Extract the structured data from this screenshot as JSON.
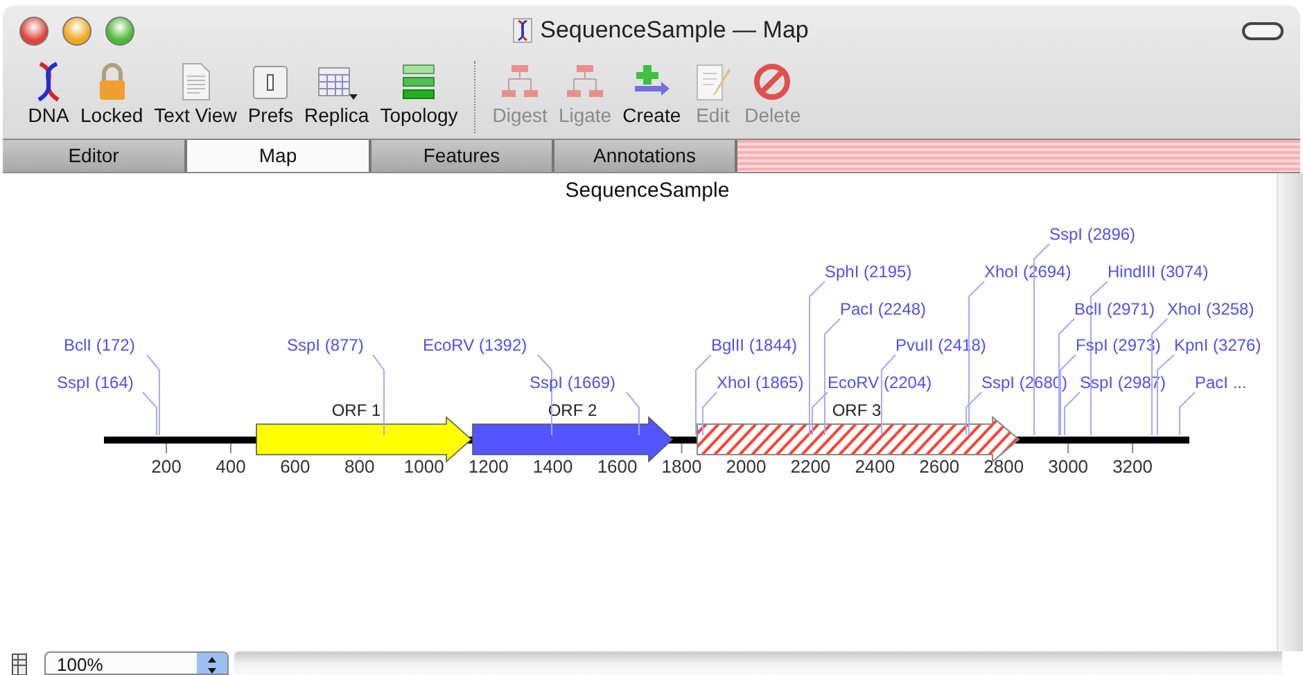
{
  "window": {
    "title": "SequenceSample — Map"
  },
  "toolbar": [
    {
      "label": "DNA",
      "kind": "dna",
      "disabled": false
    },
    {
      "label": "Locked",
      "kind": "lock",
      "disabled": false
    },
    {
      "label": "Text View",
      "kind": "document",
      "disabled": false
    },
    {
      "label": "Prefs",
      "kind": "prefs",
      "disabled": false
    },
    {
      "label": "Replica",
      "kind": "replica",
      "disabled": false
    },
    {
      "label": "Topology",
      "kind": "topology",
      "disabled": false
    },
    {
      "label": "Digest",
      "kind": "digest",
      "disabled": true
    },
    {
      "label": "Ligate",
      "kind": "ligate",
      "disabled": true
    },
    {
      "label": "Create",
      "kind": "create",
      "disabled": false
    },
    {
      "label": "Edit",
      "kind": "edit",
      "disabled": true
    },
    {
      "label": "Delete",
      "kind": "delete",
      "disabled": true
    }
  ],
  "tabs": [
    {
      "label": "Editor",
      "selected": false
    },
    {
      "label": "Map",
      "selected": true
    },
    {
      "label": "Features",
      "selected": false
    },
    {
      "label": "Annotations",
      "selected": false
    }
  ],
  "map": {
    "title": "SequenceSample",
    "features": [
      {
        "label": "ORF 1",
        "kind": "solid",
        "color": "#ffff00"
      },
      {
        "label": "ORF 2",
        "kind": "solid",
        "color": "#5555ff"
      },
      {
        "label": "ORF 3",
        "kind": "hatched",
        "color": "#ff4030"
      }
    ],
    "sites": [
      {
        "label": "BclI (172)"
      },
      {
        "label": "SspI (164)"
      },
      {
        "label": "SspI (877)"
      },
      {
        "label": "EcoRV (1392)"
      },
      {
        "label": "SspI (1669)"
      },
      {
        "label": "BglII (1844)"
      },
      {
        "label": "XhoI (1865)"
      },
      {
        "label": "SphI (2195)"
      },
      {
        "label": "PacI (2248)"
      },
      {
        "label": "EcoRV (2204)"
      },
      {
        "label": "PvuII (2418)"
      },
      {
        "label": "XhoI (2694)"
      },
      {
        "label": "SspI (2680)"
      },
      {
        "label": "SspI (2896)"
      },
      {
        "label": "HindIII (3074)"
      },
      {
        "label": "BclI (2971)"
      },
      {
        "label": "FspI (2973)"
      },
      {
        "label": "SspI (2987)"
      },
      {
        "label": "XhoI (3258)"
      },
      {
        "label": "KpnI (3276)"
      },
      {
        "label": "PacI ..."
      }
    ],
    "ticks": [
      "200",
      "400",
      "600",
      "800",
      "1000",
      "1200",
      "1400",
      "1600",
      "1800",
      "2000",
      "2200",
      "2400",
      "2600",
      "2800",
      "3000",
      "3200"
    ]
  },
  "zoom": {
    "value": "100%"
  }
}
